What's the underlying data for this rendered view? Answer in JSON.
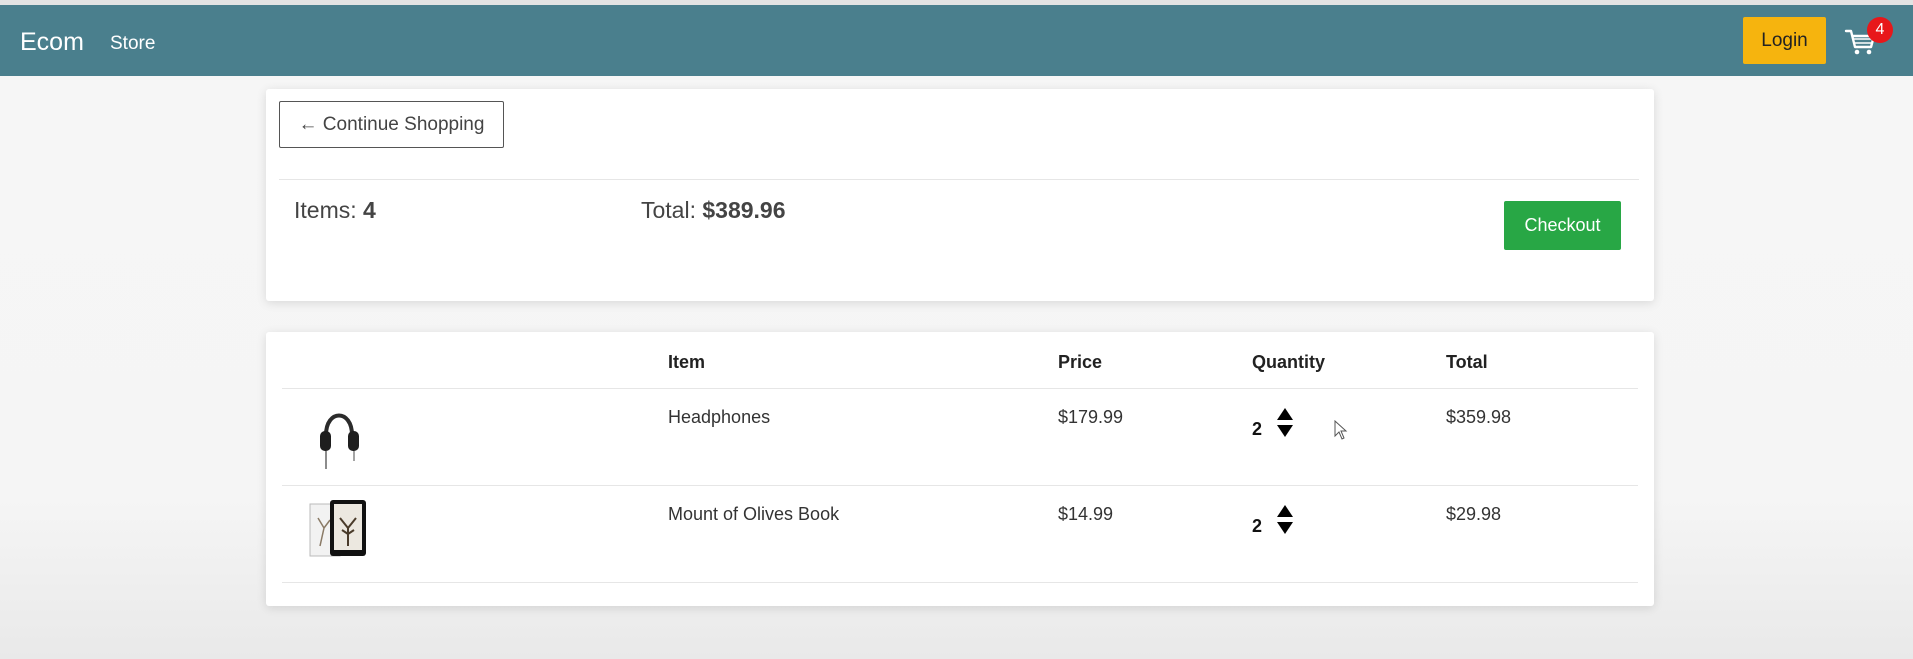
{
  "navbar": {
    "brand": "Ecom",
    "links": [
      "Store"
    ],
    "login_label": "Login",
    "cart_count": "4",
    "bg_color": "#4a7f8d"
  },
  "summary": {
    "continue_label": "← Continue Shopping",
    "items_label": "Items:",
    "items_value": "4",
    "total_label": "Total:",
    "total_value": "$389.96",
    "checkout_label": "Checkout"
  },
  "table": {
    "headers": [
      "Item",
      "Price",
      "Quantity",
      "Total"
    ],
    "rows": [
      {
        "image": "headphones-thumbnail",
        "item": "Headphones",
        "price": "$179.99",
        "quantity": "2",
        "total": "$359.98"
      },
      {
        "image": "book-thumbnail",
        "item": "Mount of Olives Book",
        "price": "$14.99",
        "quantity": "2",
        "total": "$29.98"
      }
    ]
  },
  "colors": {
    "login": "#f6b40e",
    "checkout": "#28a745",
    "badge": "#e8171a"
  }
}
